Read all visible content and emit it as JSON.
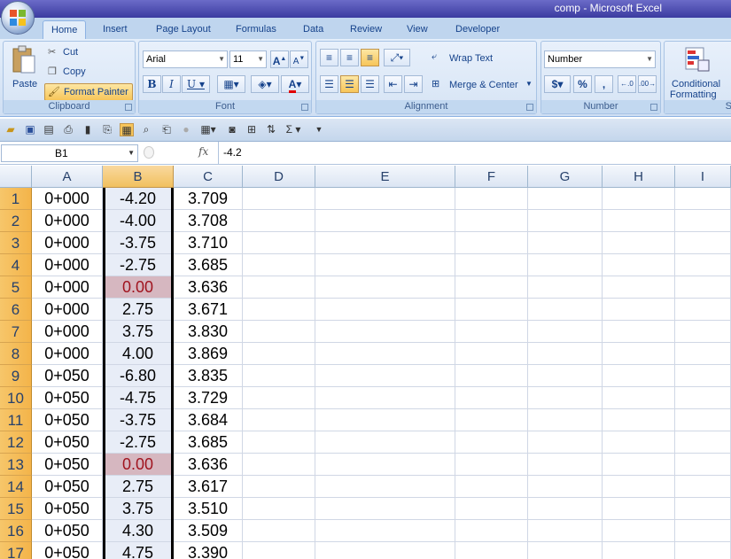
{
  "window": {
    "title": "comp - Microsoft Excel"
  },
  "tabs": [
    {
      "label": "Home",
      "active": true
    },
    {
      "label": "Insert"
    },
    {
      "label": "Page Layout"
    },
    {
      "label": "Formulas"
    },
    {
      "label": "Data"
    },
    {
      "label": "Review"
    },
    {
      "label": "View"
    },
    {
      "label": "Developer"
    }
  ],
  "clipboard": {
    "paste": "Paste",
    "cut": "Cut",
    "copy": "Copy",
    "format_painter": "Format Painter",
    "label": "Clipboard"
  },
  "font": {
    "name": "Arial",
    "size": "11",
    "label": "Font"
  },
  "alignment": {
    "wrap": "Wrap Text",
    "merge": "Merge & Center",
    "label": "Alignment"
  },
  "number": {
    "format": "Number",
    "label": "Number",
    "dollar": "$",
    "percent": "%",
    "comma": ","
  },
  "styles": {
    "conditional_line1": "Conditional",
    "conditional_line2": "Formatting",
    "partial_label": "S"
  },
  "formula_bar": {
    "name_box": "B1",
    "fx": "fx",
    "value": "-4.2"
  },
  "columns": [
    "A",
    "B",
    "C",
    "D",
    "E",
    "F",
    "G",
    "H",
    "I"
  ],
  "rows": [
    {
      "n": "1",
      "a": "0+000",
      "b": "-4.20",
      "c": "3.709"
    },
    {
      "n": "2",
      "a": "0+000",
      "b": "-4.00",
      "c": "3.708"
    },
    {
      "n": "3",
      "a": "0+000",
      "b": "-3.75",
      "c": "3.710"
    },
    {
      "n": "4",
      "a": "0+000",
      "b": "-2.75",
      "c": "3.685"
    },
    {
      "n": "5",
      "a": "0+000",
      "b": "0.00",
      "c": "3.636",
      "highlight": true
    },
    {
      "n": "6",
      "a": "0+000",
      "b": "2.75",
      "c": "3.671"
    },
    {
      "n": "7",
      "a": "0+000",
      "b": "3.75",
      "c": "3.830"
    },
    {
      "n": "8",
      "a": "0+000",
      "b": "4.00",
      "c": "3.869"
    },
    {
      "n": "9",
      "a": "0+050",
      "b": "-6.80",
      "c": "3.835"
    },
    {
      "n": "10",
      "a": "0+050",
      "b": "-4.75",
      "c": "3.729"
    },
    {
      "n": "11",
      "a": "0+050",
      "b": "-3.75",
      "c": "3.684"
    },
    {
      "n": "12",
      "a": "0+050",
      "b": "-2.75",
      "c": "3.685"
    },
    {
      "n": "13",
      "a": "0+050",
      "b": "0.00",
      "c": "3.636",
      "highlight": true
    },
    {
      "n": "14",
      "a": "0+050",
      "b": "2.75",
      "c": "3.617"
    },
    {
      "n": "15",
      "a": "0+050",
      "b": "3.75",
      "c": "3.510"
    },
    {
      "n": "16",
      "a": "0+050",
      "b": "4.30",
      "c": "3.509"
    },
    {
      "n": "17",
      "a": "0+050",
      "b": "4.75",
      "c": "3.390"
    }
  ],
  "colors": {
    "highlight_fill": "#d6b7c0",
    "highlight_text": "#a0141f",
    "selected_column": "#e8edf7"
  }
}
